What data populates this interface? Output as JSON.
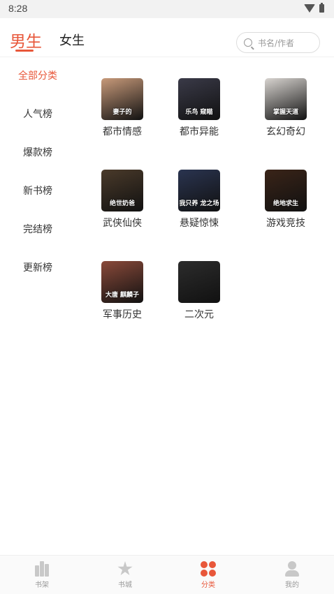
{
  "status_bar": {
    "time": "8:28"
  },
  "header": {
    "tabs": [
      {
        "label": "男生",
        "active": true
      },
      {
        "label": "女生",
        "active": false
      }
    ],
    "search": {
      "placeholder": "书名/作者"
    }
  },
  "sidebar": {
    "items": [
      {
        "label": "全部分类",
        "active": true
      },
      {
        "label": "人气榜",
        "active": false
      },
      {
        "label": "爆款榜",
        "active": false
      },
      {
        "label": "新书榜",
        "active": false
      },
      {
        "label": "完结榜",
        "active": false
      },
      {
        "label": "更新榜",
        "active": false
      }
    ]
  },
  "categories": [
    {
      "label": "都市情感",
      "cover_text": "妻子的",
      "cover_color": "#c89a7a"
    },
    {
      "label": "都市异能",
      "cover_text": "乐鸟 窥瞄",
      "cover_color": "#3a3a48"
    },
    {
      "label": "玄幻奇幻",
      "cover_text": "掌握天道",
      "cover_color": "#d8d4d0"
    },
    {
      "label": "武侠仙侠",
      "cover_text": "绝世奶爸",
      "cover_color": "#4a3a2a"
    },
    {
      "label": "悬疑惊悚",
      "cover_text": "我只养 龙之场",
      "cover_color": "#2a3450"
    },
    {
      "label": "游戏竞技",
      "cover_text": "绝地求生",
      "cover_color": "#3a2418"
    },
    {
      "label": "军事历史",
      "cover_text": "大唐 麒麟子",
      "cover_color": "#8a4a3a"
    },
    {
      "label": "二次元",
      "cover_text": "",
      "cover_color": "#2c2c2c"
    }
  ],
  "bottom_nav": [
    {
      "label": "书架",
      "icon": "bookshelf-icon",
      "active": false
    },
    {
      "label": "书城",
      "icon": "star-icon",
      "active": false
    },
    {
      "label": "分类",
      "icon": "category-icon",
      "active": true
    },
    {
      "label": "我的",
      "icon": "profile-icon",
      "active": false
    }
  ],
  "colors": {
    "accent": "#e8573a",
    "inactive": "#c8c8c8"
  }
}
